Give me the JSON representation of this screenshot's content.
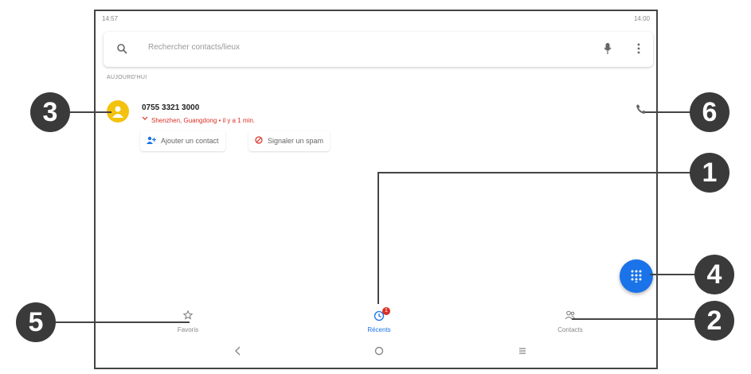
{
  "status": {
    "time": "14:57",
    "battery": "14:00"
  },
  "search": {
    "placeholder": "Rechercher contacts/lieux"
  },
  "section_label": "AUJOURD'HUI",
  "call": {
    "number": "0755 3321 3000",
    "detail": "Shenzhen, Guangdong • il y a 1 min.",
    "add_contact_label": "Ajouter un contact",
    "spam_label": "Signaler un spam"
  },
  "tabs": {
    "favorites": "Favoris",
    "recents": "Récents",
    "contacts": "Contacts",
    "recents_badge": "1"
  },
  "callouts": [
    "1",
    "2",
    "3",
    "4",
    "5",
    "6"
  ],
  "colors": {
    "accent": "#1a73e8",
    "avatar": "#f4c20d",
    "missed": "#d93025"
  }
}
